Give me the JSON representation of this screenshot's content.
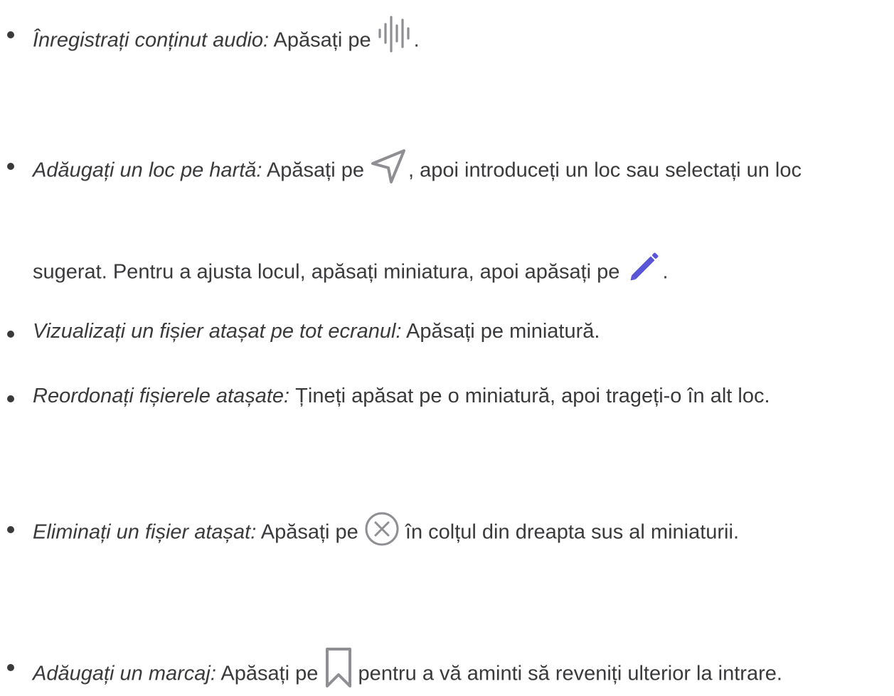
{
  "items": [
    {
      "lead": "Înregistrați conținut audio:",
      "before": " Apăsați pe ",
      "icon": "waveform-icon",
      "after": "."
    },
    {
      "lead": "Adăugați un loc pe hartă:",
      "before": " Apăsați pe ",
      "icon": "location-arrow-icon",
      "after": ", apoi introduceți un loc sau selectați un loc",
      "line2_before": "sugerat. Pentru a ajusta locul, apăsați miniatura, apoi apăsați pe ",
      "line2_icon": "pencil-icon",
      "line2_after": "."
    },
    {
      "lead": "Vizualizați un fișier atașat pe tot ecranul:",
      "before": " Apăsați pe miniatură."
    },
    {
      "lead": "Reordonați fișierele atașate:",
      "before": " Țineți apăsat pe o miniatură, apoi trageți-o în alt loc."
    },
    {
      "lead": "Eliminați un fișier atașat:",
      "before": " Apăsați pe ",
      "icon": "close-circle-icon",
      "after": " în colțul din dreapta sus al miniaturii."
    },
    {
      "lead": "Adăugați un marcaj:",
      "before": " Apăsați pe ",
      "icon": "bookmark-icon",
      "after": " pentru a vă aminti să reveniți ulterior la intrare."
    }
  ],
  "colors": {
    "text": "#3a3a3c",
    "icon_gray": "#8e8e93",
    "pencil_accent": "#5856d6"
  }
}
